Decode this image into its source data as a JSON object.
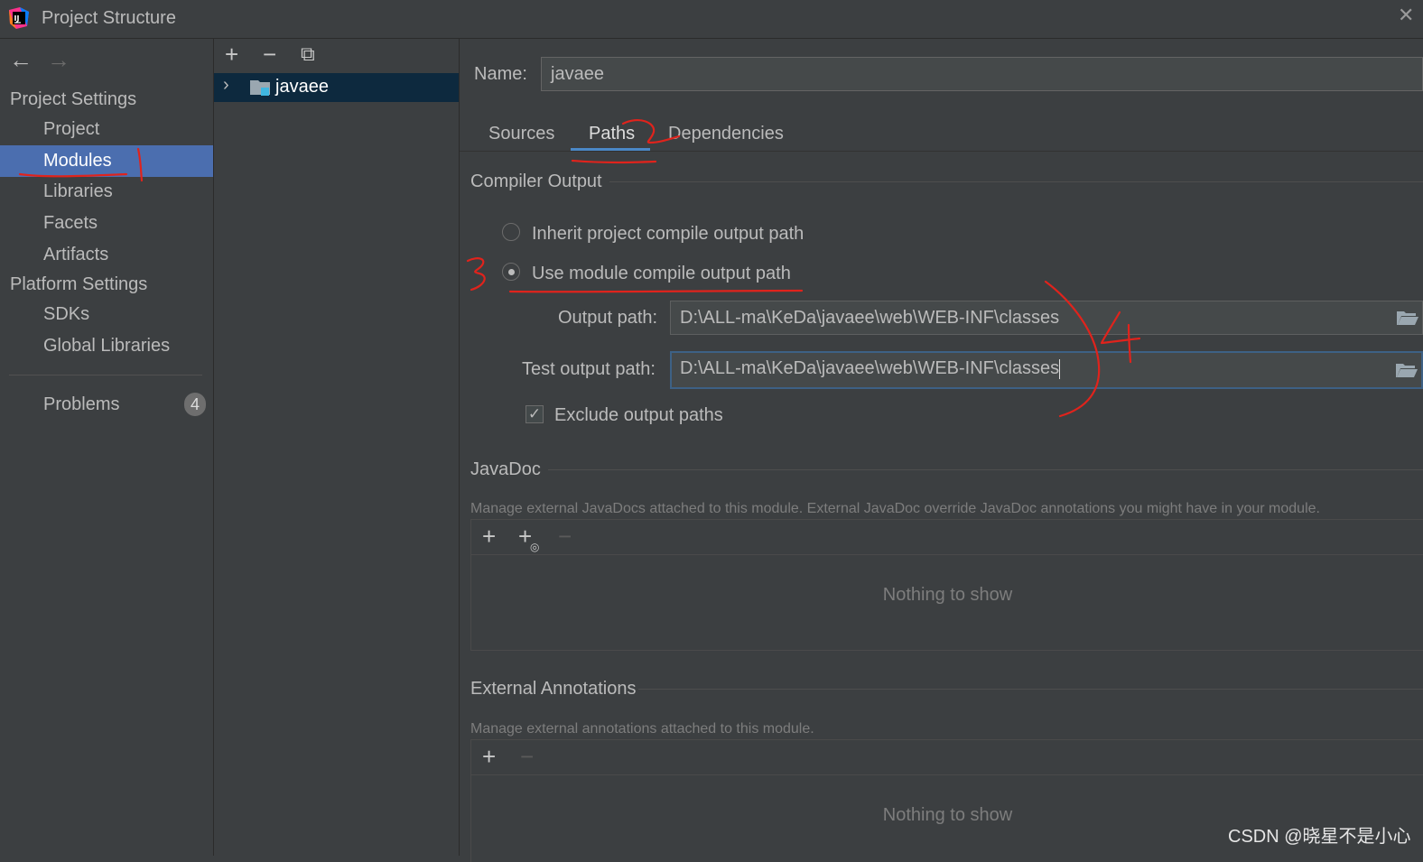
{
  "window": {
    "title": "Project Structure",
    "close_glyph": "✕"
  },
  "nav": {
    "back": "←",
    "forward": "→",
    "project_settings": "Project Settings",
    "platform_settings": "Platform Settings",
    "items": [
      {
        "label": "Project"
      },
      {
        "label": "Modules"
      },
      {
        "label": "Libraries"
      },
      {
        "label": "Facets"
      },
      {
        "label": "Artifacts"
      },
      {
        "label": "SDKs"
      },
      {
        "label": "Global Libraries"
      },
      {
        "label": "Problems"
      }
    ],
    "problems_count": "4"
  },
  "tree": {
    "toolbar": {
      "add": "+",
      "remove": "−",
      "copy": "⧉"
    },
    "chevron": "›",
    "module_name": "javaee"
  },
  "module": {
    "name_label": "Name:",
    "name_value": "javaee",
    "tabs": [
      "Sources",
      "Paths",
      "Dependencies"
    ],
    "active_tab": "Paths",
    "compiler_output": {
      "title": "Compiler Output",
      "inherit_label": "Inherit project compile output path",
      "use_module_label": "Use module compile output path",
      "selected": "use_module",
      "output_path_label": "Output path:",
      "output_path": "D:\\ALL-ma\\KeDa\\javaee\\web\\WEB-INF\\classes",
      "test_output_path_label": "Test output path:",
      "test_output_path": "D:\\ALL-ma\\KeDa\\javaee\\web\\WEB-INF\\classes",
      "exclude_label": "Exclude output paths",
      "exclude_checked": true,
      "check_glyph": "✓"
    },
    "javadoc": {
      "title": "JavaDoc",
      "description": "Manage external JavaDocs attached to this module. External JavaDoc override JavaDoc annotations you might have in your module.",
      "add": "+",
      "add_url": "+",
      "remove": "−",
      "empty": "Nothing to show"
    },
    "annotations": {
      "title": "External Annotations",
      "description": "Manage external annotations attached to this module.",
      "add": "+",
      "remove": "−",
      "empty": "Nothing to show"
    }
  },
  "watermark": "CSDN @晓星不是小心",
  "annotation_color": "#e0231c",
  "accent_color": "#4b6eaf"
}
